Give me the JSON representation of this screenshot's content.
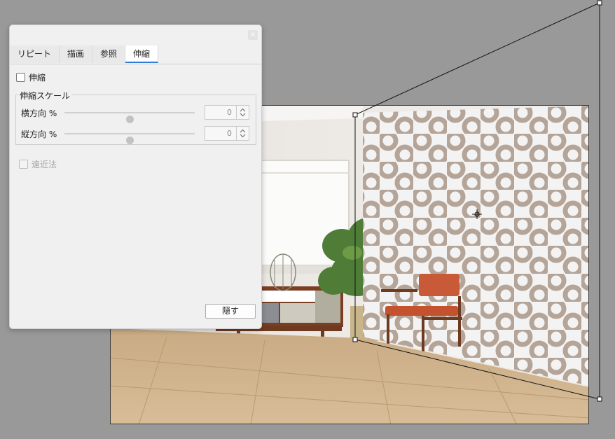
{
  "dialog": {
    "close_icon": "×",
    "tabs": [
      {
        "label": "リピート",
        "active": false
      },
      {
        "label": "描画",
        "active": false
      },
      {
        "label": "参照",
        "active": false
      },
      {
        "label": "伸縮",
        "active": true
      }
    ],
    "stretch_checkbox": {
      "label": "伸縮",
      "checked": false
    },
    "scale_group": {
      "title": "伸縮スケール",
      "horizontal": {
        "label": "横方向 %",
        "value": "0",
        "slider_fraction": 0.5
      },
      "vertical": {
        "label": "縦方向 %",
        "value": "0",
        "slider_fraction": 0.5
      }
    },
    "perspective_checkbox": {
      "label": "遠近法",
      "checked": false,
      "disabled": true
    },
    "hide_button": "隠す"
  },
  "colors": {
    "workspace_bg": "#999999",
    "tab_active_underline": "#2f7bd6",
    "pattern_ring": "#b5a598",
    "pattern_bg": "#f4f3f3"
  },
  "icons": {
    "center_pivot": "crosshair-icon",
    "spinner": "up-down-arrows-icon"
  }
}
